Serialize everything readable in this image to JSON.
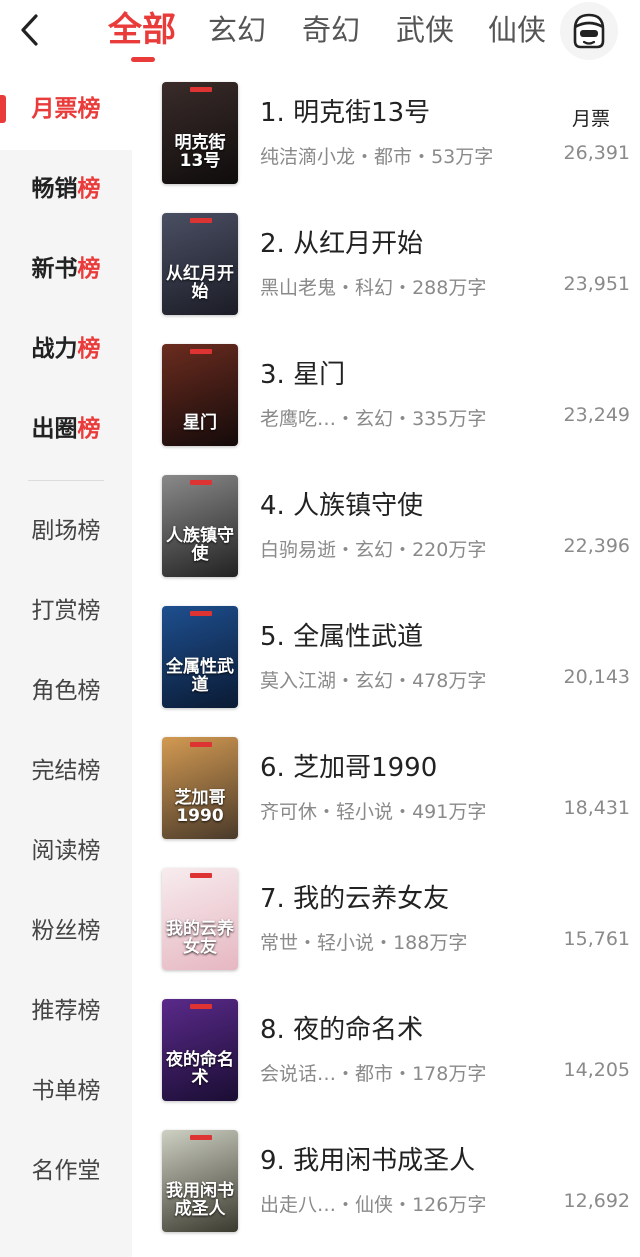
{
  "tabs": [
    {
      "label": "全部",
      "active": true
    },
    {
      "label": "玄幻"
    },
    {
      "label": "奇幻"
    },
    {
      "label": "武侠"
    },
    {
      "label": "仙侠"
    }
  ],
  "sidebar": {
    "primary": [
      {
        "label_a": "月票",
        "label_b": "榜",
        "active": true
      },
      {
        "label_a": "畅销",
        "label_b": "榜"
      },
      {
        "label_a": "新书",
        "label_b": "榜"
      },
      {
        "label_a": "战力",
        "label_b": "榜"
      },
      {
        "label_a": "出圈",
        "label_b": "榜"
      }
    ],
    "secondary": [
      "剧场榜",
      "打赏榜",
      "角色榜",
      "完结榜",
      "阅读榜",
      "粉丝榜",
      "推荐榜",
      "书单榜",
      "名作堂"
    ]
  },
  "metric_label": "月票",
  "books": [
    {
      "rank": "1.",
      "title": "明克街13号",
      "author": "纯洁滴小龙",
      "genre": "都市",
      "words": "53万字",
      "count": "26,391",
      "cover_text": "明克街13号",
      "cover_colors": [
        "#3a2c2a",
        "#0f0c0c"
      ]
    },
    {
      "rank": "2.",
      "title": "从红月开始",
      "author": "黑山老鬼",
      "genre": "科幻",
      "words": "288万字",
      "count": "23,951",
      "cover_text": "从红月开始",
      "cover_colors": [
        "#4a4f63",
        "#1b1c26"
      ]
    },
    {
      "rank": "3.",
      "title": "星门",
      "author": "老鹰吃…",
      "genre": "玄幻",
      "words": "335万字",
      "count": "23,249",
      "cover_text": "星门",
      "cover_colors": [
        "#6b2c1f",
        "#140a0a"
      ]
    },
    {
      "rank": "4.",
      "title": "人族镇守使",
      "author": "白驹易逝",
      "genre": "玄幻",
      "words": "220万字",
      "count": "22,396",
      "cover_text": "人族镇守使",
      "cover_colors": [
        "#8a8a8a",
        "#222222"
      ]
    },
    {
      "rank": "5.",
      "title": "全属性武道",
      "author": "莫入江湖",
      "genre": "玄幻",
      "words": "478万字",
      "count": "20,143",
      "cover_text": "全属性武道",
      "cover_colors": [
        "#1e4f8f",
        "#0a1a33"
      ]
    },
    {
      "rank": "6.",
      "title": "芝加哥1990",
      "author": "齐可休",
      "genre": "轻小说",
      "words": "491万字",
      "count": "18,431",
      "cover_text": "芝加哥1990",
      "cover_colors": [
        "#d39a52",
        "#4a3a2a"
      ]
    },
    {
      "rank": "7.",
      "title": "我的云养女友",
      "author": "常世",
      "genre": "轻小说",
      "words": "188万字",
      "count": "15,761",
      "cover_text": "我的云养女友",
      "cover_colors": [
        "#f7ecee",
        "#e6b7c2"
      ]
    },
    {
      "rank": "8.",
      "title": "夜的命名术",
      "author": "会说话…",
      "genre": "都市",
      "words": "178万字",
      "count": "14,205",
      "cover_text": "夜的命名术",
      "cover_colors": [
        "#5a2a8a",
        "#1a0d33"
      ]
    },
    {
      "rank": "9.",
      "title": "我用闲书成圣人",
      "author": "出走八…",
      "genre": "仙侠",
      "words": "126万字",
      "count": "12,692",
      "cover_text": "我用闲书成圣人",
      "cover_colors": [
        "#cfd0c4",
        "#3a3a2e"
      ]
    }
  ],
  "separator": "・",
  "colors": {
    "accent": "#ea3b3b",
    "muted": "#8a8a8a",
    "sidebar_bg": "#f5f5f5"
  },
  "icons": {
    "back": "chevron-left-icon",
    "avatar": "user-avatar-icon"
  }
}
